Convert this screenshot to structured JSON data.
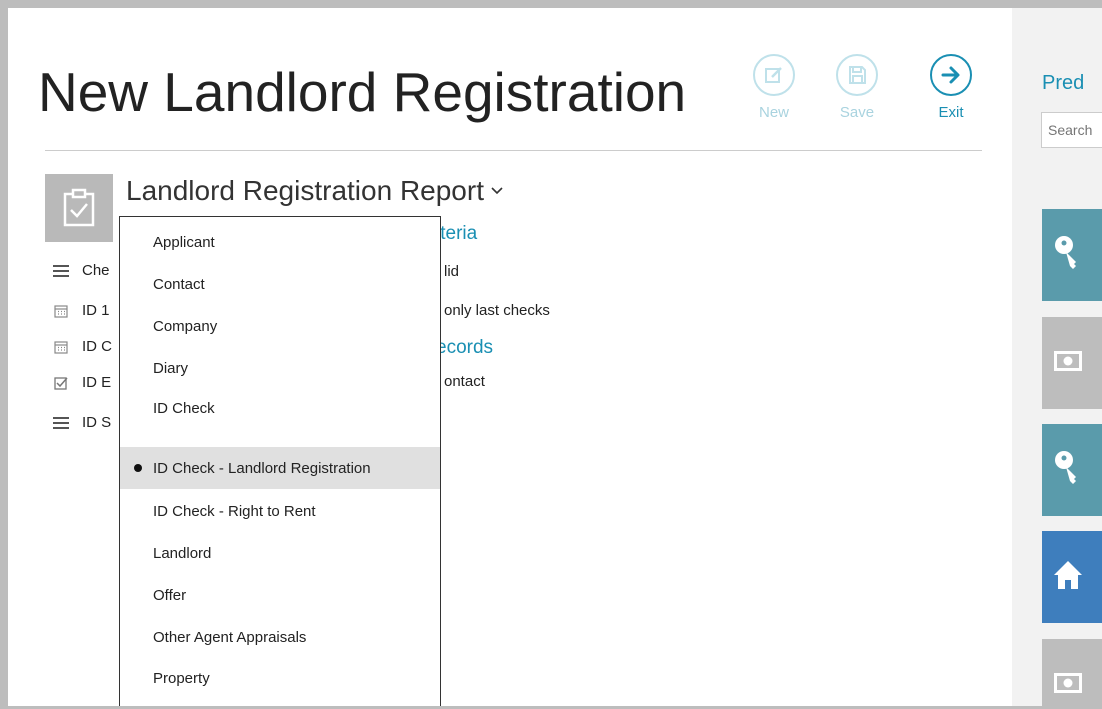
{
  "header": {
    "title": "New Landlord Registration"
  },
  "toolbar": {
    "new_label": "New",
    "save_label": "Save",
    "exit_label": "Exit"
  },
  "report": {
    "title": "Landlord Registration Report",
    "fields": [
      {
        "label": "Che",
        "icon": "list-icon"
      },
      {
        "label": "ID 1",
        "icon": "calendar-icon"
      },
      {
        "label": "ID C",
        "icon": "calendar-icon"
      },
      {
        "label": "ID E",
        "icon": "checkbox-icon"
      },
      {
        "label": "ID S",
        "icon": "list-icon"
      }
    ],
    "criteria_heading": "iteria",
    "criteria": [
      "lid",
      "only last checks"
    ],
    "records_heading": "ecords",
    "records": [
      "ontact"
    ]
  },
  "dropdown": {
    "items": [
      "Applicant",
      "Contact",
      "Company",
      "Diary",
      "ID Check",
      "ID Check - Landlord Registration",
      "ID Check - Right to Rent",
      "Landlord",
      "Offer",
      "Other Agent Appraisals",
      "Property"
    ],
    "selected": "ID Check - Landlord Registration"
  },
  "right_pane": {
    "title": "Pred",
    "search_placeholder": "Search",
    "tiles": [
      {
        "icon": "key-icon",
        "color": "#5a9bab"
      },
      {
        "icon": "money-icon",
        "color": "#bdbdbd"
      },
      {
        "icon": "key-icon",
        "color": "#5a9bab"
      },
      {
        "icon": "house-icon",
        "color": "#3e7ebd"
      },
      {
        "icon": "money-icon",
        "color": "#bdbdbd"
      }
    ]
  },
  "colors": {
    "accent": "#1a8fb3",
    "disabled_accent": "#bfe1ea",
    "selected_row": "#e0e0e0"
  }
}
